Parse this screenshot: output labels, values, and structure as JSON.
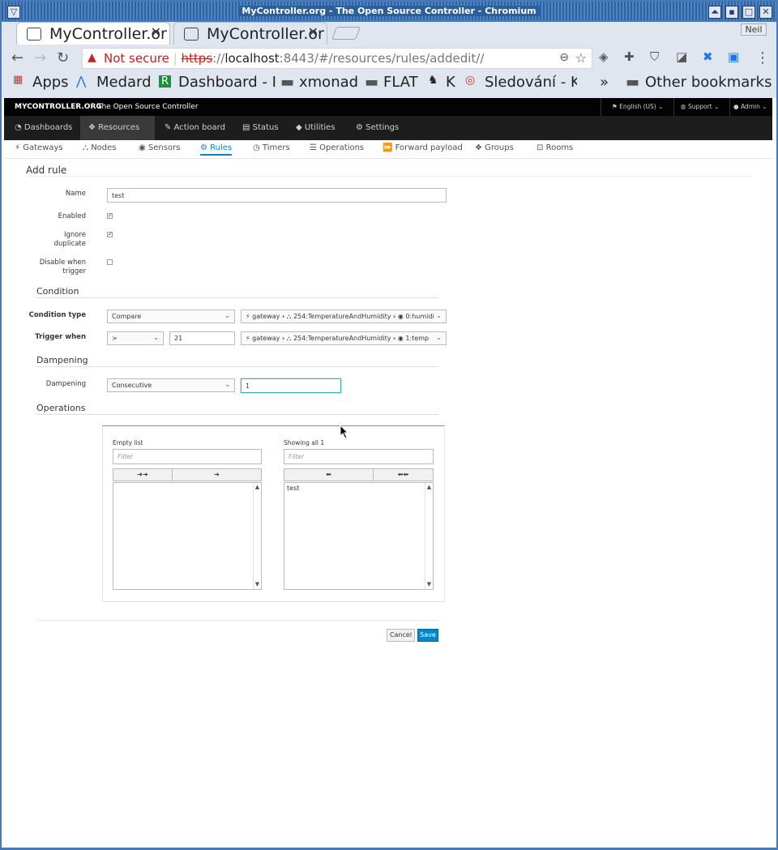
{
  "window": {
    "title": "MyController.org - The Open Source Controller - Chromium"
  },
  "browser": {
    "tabs": [
      {
        "label": "MyController.or"
      },
      {
        "label": "MyController.or"
      }
    ],
    "profile": "Neil",
    "omnibox": {
      "security": "Not secure",
      "scheme": "https",
      "host": "localhost",
      "rest": ":8443/#/resources/rules/addedit//"
    },
    "bookmarks": [
      "Apps",
      "Medard",
      "Dashboard - I",
      "xmonad",
      "FLAT",
      "K",
      "Sledování - K",
      "»",
      "Other bookmarks"
    ]
  },
  "app": {
    "brand": "MYCONTROLLER.ORG",
    "brand_sub": "The Open Source Controller",
    "language": "English (US)",
    "support": "Support",
    "user": "Admin",
    "main_tabs": [
      "Dashboards",
      "Resources",
      "Action board",
      "Status",
      "Utilities",
      "Settings"
    ],
    "sub_tabs": [
      "Gateways",
      "Nodes",
      "Sensors",
      "Rules",
      "Timers",
      "Operations",
      "Forward payload",
      "Groups",
      "Rooms"
    ]
  },
  "form": {
    "heading": "Add rule",
    "name_label": "Name",
    "name_value": "test",
    "enabled_label": "Enabled",
    "ignore_label1": "Ignore",
    "ignore_label2": "duplicate",
    "disable_label1": "Disable when",
    "disable_label2": "trigger",
    "condition_section": "Condition",
    "condition_type_label": "Condition type",
    "condition_type_value": "Compare",
    "cond_path1": {
      "gw": "gateway",
      "node": "254:TemperatureAndHumidity",
      "sensor": "0:humidi"
    },
    "trigger_label": "Trigger when",
    "trigger_op": ">",
    "trigger_value": "21",
    "cond_path2": {
      "gw": "gateway",
      "node": "254:TemperatureAndHumidity",
      "sensor": "1:temp"
    },
    "dampening_section": "Dampening",
    "dampening_label": "Dampening",
    "dampening_value": "Consecutive",
    "dampening_count": "1",
    "operations_section": "Operations",
    "left_list": {
      "title": "Empty list",
      "filter": "Filter",
      "items": []
    },
    "right_list": {
      "title": "Showing all 1",
      "filter": "Filter",
      "items": [
        "test"
      ]
    },
    "cancel": "Cancel",
    "save": "Save"
  }
}
